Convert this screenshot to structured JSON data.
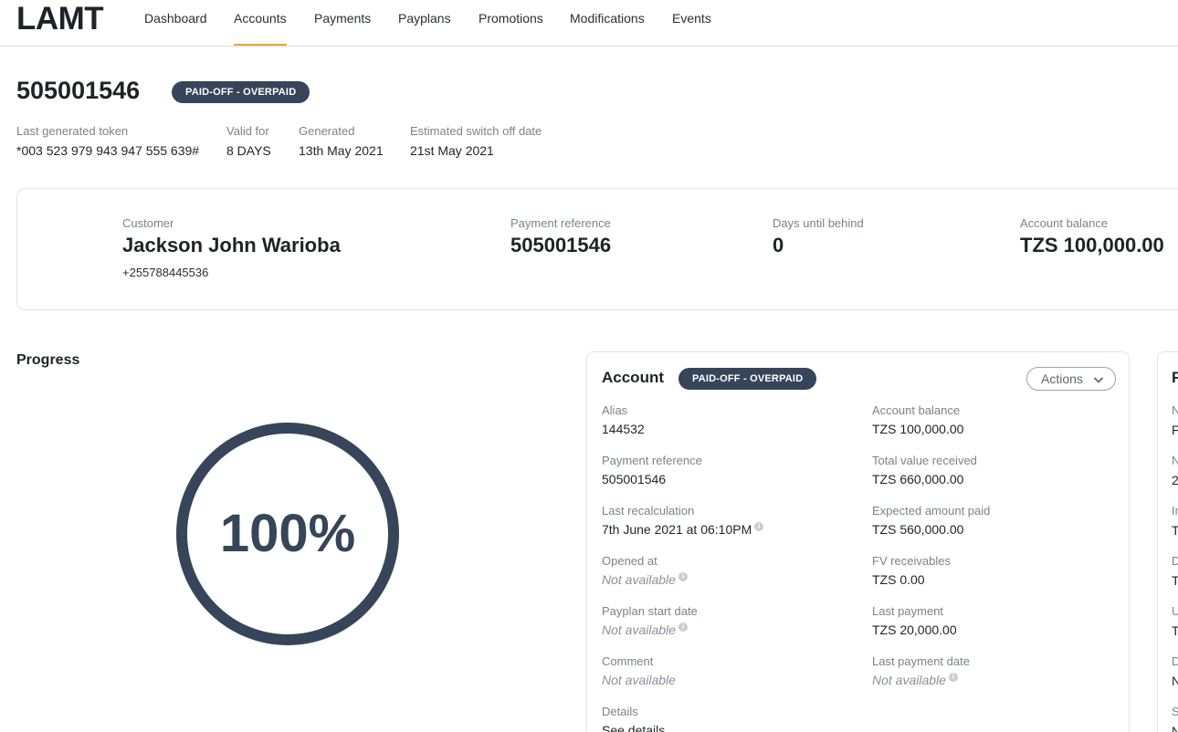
{
  "nav": {
    "logo": "LAMT",
    "items": [
      "Dashboard",
      "Accounts",
      "Payments",
      "Payplans",
      "Promotions",
      "Modifications",
      "Events"
    ],
    "active": "Accounts"
  },
  "header": {
    "account_id": "505001546",
    "status": "PAID-OFF - OVERPAID",
    "meta": [
      {
        "label": "Last generated token",
        "value": "*003 523 979 943 947 555 639#"
      },
      {
        "label": "Valid for",
        "value": "8 DAYS"
      },
      {
        "label": "Generated",
        "value": "13th May 2021"
      },
      {
        "label": "Estimated switch off date",
        "value": "21st May 2021"
      }
    ]
  },
  "summary": {
    "customer_label": "Customer",
    "customer_name": "Jackson John Warioba",
    "customer_phone": "+255788445536",
    "payment_ref_label": "Payment reference",
    "payment_ref": "505001546",
    "days_label": "Days until behind",
    "days": "0",
    "balance_label": "Account balance",
    "balance": "TZS 100,000.00"
  },
  "progress": {
    "title": "Progress",
    "percent_text": "100%",
    "fraction": 1.0,
    "ring_color": "#364559"
  },
  "account": {
    "title": "Account",
    "status": "PAID-OFF - OVERPAID",
    "actions_label": "Actions",
    "left_fields": [
      {
        "label": "Alias",
        "value": "144532",
        "na": false,
        "info": false
      },
      {
        "label": "Payment reference",
        "value": "505001546",
        "na": false,
        "info": false
      },
      {
        "label": "Last recalculation",
        "value": "7th June 2021 at 06:10PM",
        "na": false,
        "info": true
      },
      {
        "label": "Opened at",
        "value": "Not available",
        "na": true,
        "info": true
      },
      {
        "label": "Payplan start date",
        "value": "Not available",
        "na": true,
        "info": true
      },
      {
        "label": "Comment",
        "value": "Not available",
        "na": true,
        "info": false
      },
      {
        "label": "Details",
        "value": "See details",
        "na": false,
        "info": false
      }
    ],
    "right_fields": [
      {
        "label": "Account balance",
        "value": "TZS 100,000.00",
        "na": false,
        "info": false
      },
      {
        "label": "Total value received",
        "value": "TZS 660,000.00",
        "na": false,
        "info": false
      },
      {
        "label": "Expected amount paid",
        "value": "TZS 560,000.00",
        "na": false,
        "info": false
      },
      {
        "label": "FV receivables",
        "value": "TZS 0.00",
        "na": false,
        "info": false
      },
      {
        "label": "Last payment",
        "value": "TZS 20,000.00",
        "na": false,
        "info": false
      },
      {
        "label": "Last payment date",
        "value": "Not available",
        "na": true,
        "info": true
      }
    ]
  },
  "right_card": {
    "title_fragment": "F",
    "fragments": [
      "N",
      "F",
      "N",
      "2",
      "Ir",
      "T",
      "D",
      "T",
      "U",
      "T",
      "D",
      "N",
      "S",
      "N"
    ]
  },
  "colors": {
    "accent": "#f0a733",
    "badge": "#364559"
  }
}
